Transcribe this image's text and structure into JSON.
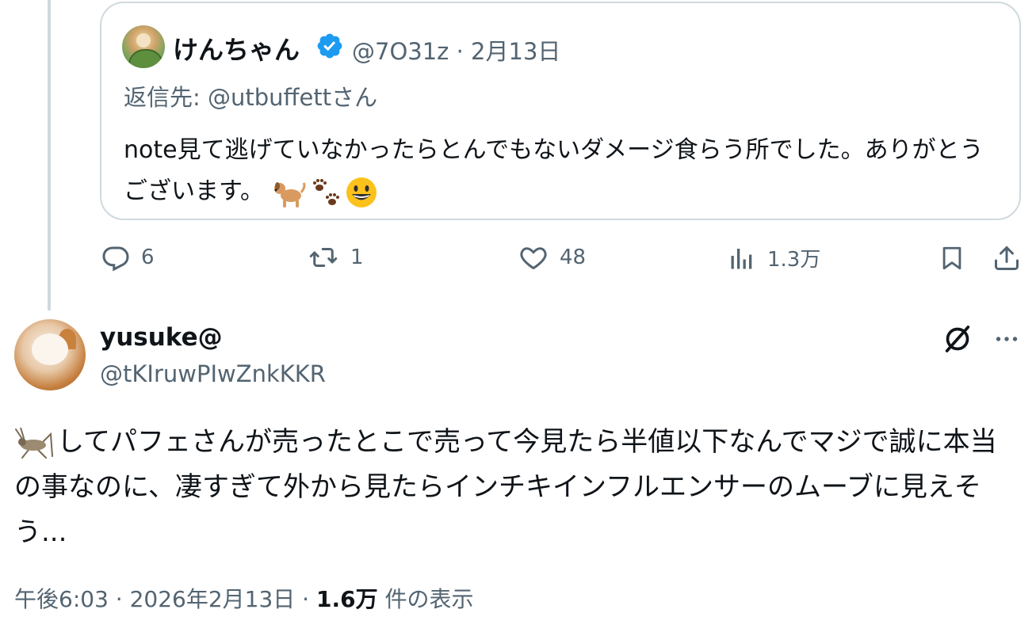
{
  "quoted_post": {
    "name": "けんちゃん",
    "handle_date": "@7O31z · 2月13日",
    "reply_to": "返信先: @utbuffettさん",
    "text": "note見て逃げていなかったらとんでもないダメージ食らう所でした。ありがとうございます。",
    "emojis": [
      "dog",
      "paw-prints",
      "smiling-face"
    ]
  },
  "actions": {
    "reply_count": "6",
    "repost_count": "1",
    "like_count": "48",
    "views_count": "1.3万"
  },
  "post": {
    "author_name": "yusuke@",
    "author_handle": "@tKIruwPIwZnkKKR",
    "text": "してパフェさんが売ったとこで売って今見たら半値以下なんでマジで誠に本当の事なのに、凄すぎて外から見たらインチキインフルエンサーのムーブに見えそう...",
    "leading_emoji": "cricket"
  },
  "meta": {
    "time_date": "午後6:03 · 2026年2月13日 · ",
    "views": "1.6万",
    "views_label": " 件の表示"
  },
  "colors": {
    "text_primary": "#0f1419",
    "text_secondary": "#536471",
    "border": "#cfd9de",
    "verified": "#1d9bf0"
  }
}
